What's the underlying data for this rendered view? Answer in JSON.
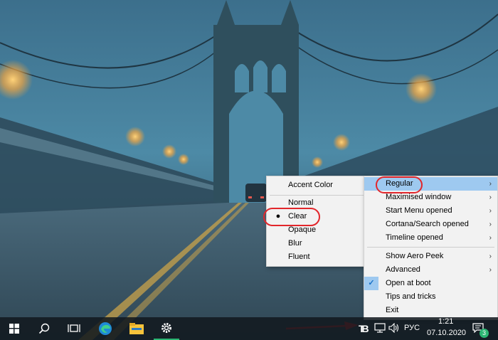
{
  "accent_menu": {
    "items": [
      {
        "label": "Accent Color"
      },
      {
        "label": "Normal"
      },
      {
        "label": "Clear",
        "selected": true
      },
      {
        "label": "Opaque"
      },
      {
        "label": "Blur"
      },
      {
        "label": "Fluent"
      }
    ]
  },
  "main_menu": {
    "items": [
      {
        "label": "Regular",
        "submenu": true,
        "highlighted": true
      },
      {
        "label": "Maximised window",
        "submenu": true
      },
      {
        "label": "Start Menu opened",
        "submenu": true
      },
      {
        "label": "Cortana/Search opened",
        "submenu": true
      },
      {
        "label": "Timeline opened",
        "submenu": true
      },
      {
        "label": "Show Aero Peek",
        "submenu": true
      },
      {
        "label": "Advanced",
        "submenu": true
      },
      {
        "label": "Open at boot",
        "checked": true
      },
      {
        "label": "Tips and tricks"
      },
      {
        "label": "Exit"
      }
    ]
  },
  "taskbar": {
    "language": "РУС",
    "time": "1:21",
    "date": "07.10.2020",
    "notification_count": "3",
    "translucenttb_glyph": "TB"
  },
  "icons": {
    "start": "windows-logo-icon",
    "search": "search-icon",
    "task_view": "task-view-icon",
    "edge": "edge-icon",
    "explorer": "file-explorer-icon",
    "settings": "gear-icon",
    "network": "network-icon",
    "volume": "volume-icon",
    "notifications": "action-center-icon"
  },
  "colors": {
    "annotation_red": "#e2262b",
    "menu_highlight": "#9ec9f0",
    "check_blue": "#1a73c9",
    "accent_green": "#2bb673"
  }
}
